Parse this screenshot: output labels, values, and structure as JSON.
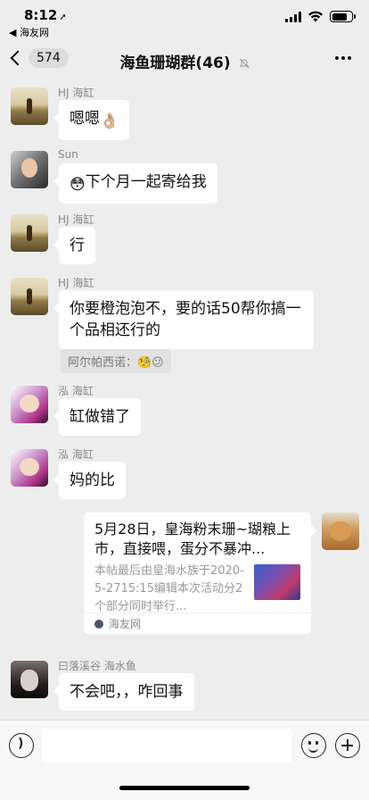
{
  "status_bar": {
    "time": "8:12",
    "location_glyph": "➚",
    "back_app": "◀ 海友网"
  },
  "nav": {
    "unread_count": "574",
    "title": "海鱼珊瑚群(46)",
    "mute_icon": "bell-slash-icon"
  },
  "messages": [
    {
      "sender": "HJ 海缸",
      "text": "嗯嗯",
      "emoji": "👌🏼"
    },
    {
      "sender": "Sun",
      "emoji_prefix": "😳",
      "text": "下个月一起寄给我"
    },
    {
      "sender": "HJ 海缸",
      "text": "行"
    },
    {
      "sender": "HJ 海缸",
      "text": "你要橙泡泡不，要的话50帮你搞一个品相还行的",
      "quote": "阿尔帕西诺：🧐😕"
    },
    {
      "sender": "泓 海缸",
      "text": "缸做错了"
    },
    {
      "sender": "泓 海缸",
      "text": "妈的比"
    },
    {
      "sender": "曰落溪谷 海水鱼",
      "text": "不会吧，，咋回事"
    }
  ],
  "link_card": {
    "title": "5月28日，皇海粉末珊~瑚粮上市，直接喂，蛋分不暴冲...",
    "description": "本帖最后由皇海水族于2020-5-2715:15编辑本次活动分2个部分同时举行...",
    "source": "海友网"
  },
  "input_bar": {
    "placeholder": ""
  }
}
